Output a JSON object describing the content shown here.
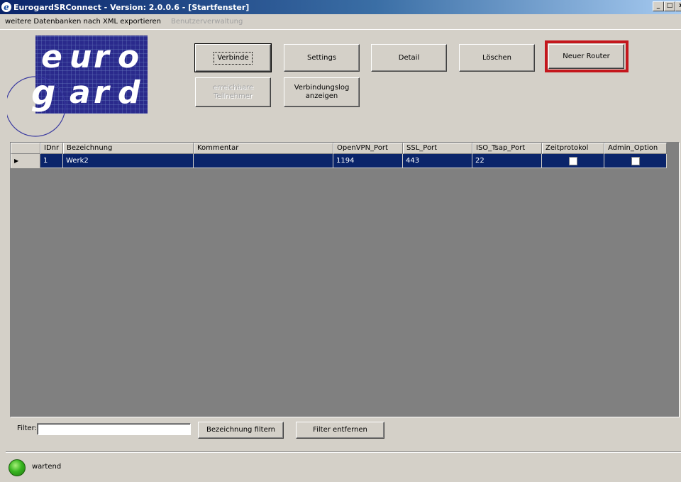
{
  "window": {
    "title": "EurogardSRConnect - Version: 2.0.0.6 - [Startfenster]",
    "controls": [
      "_",
      "□",
      "x"
    ]
  },
  "menu": [
    {
      "label": "weitere Datenbanken nach XML exportieren",
      "enabled": true
    },
    {
      "label": "Benutzerverwaltung",
      "enabled": false
    }
  ],
  "logo": {
    "row1": [
      "e",
      "u",
      "r",
      "o"
    ],
    "row2": [
      "g",
      "a",
      "r",
      "d"
    ]
  },
  "buttons": {
    "verbinde": "Verbinde",
    "settings": "Settings",
    "detail": "Detail",
    "loeschen": "Löschen",
    "neuer_router": "Neuer Router",
    "erreichbare_line1": "erreichbare",
    "erreichbare_line2": "Teilnehmer",
    "verbindungslog_line1": "Verbindungslog",
    "verbindungslog_line2": "anzeigen"
  },
  "table": {
    "columns": [
      "IDnr",
      "Bezeichnung",
      "Kommentar",
      "OpenVPN_Port",
      "SSL_Port",
      "ISO_Tsap_Port",
      "Zeitprotokol",
      "Admin_Option"
    ],
    "rows": [
      {
        "IDnr": "1",
        "Bezeichnung": "Werk2",
        "Kommentar": "",
        "OpenVPN_Port": "1194",
        "SSL_Port": "443",
        "ISO_Tsap_Port": "22",
        "Zeitprotokol": false,
        "Admin_Option": false
      }
    ]
  },
  "filter": {
    "label": "Filter:",
    "value": "",
    "apply_button": "Bezeichnung filtern",
    "remove_button": "Filter entfernen"
  },
  "status": {
    "text": "wartend",
    "led_color": "#38b520"
  },
  "colors": {
    "selection": "#0a246a",
    "highlight": "#c4161c",
    "grid_bg": "#808080"
  }
}
